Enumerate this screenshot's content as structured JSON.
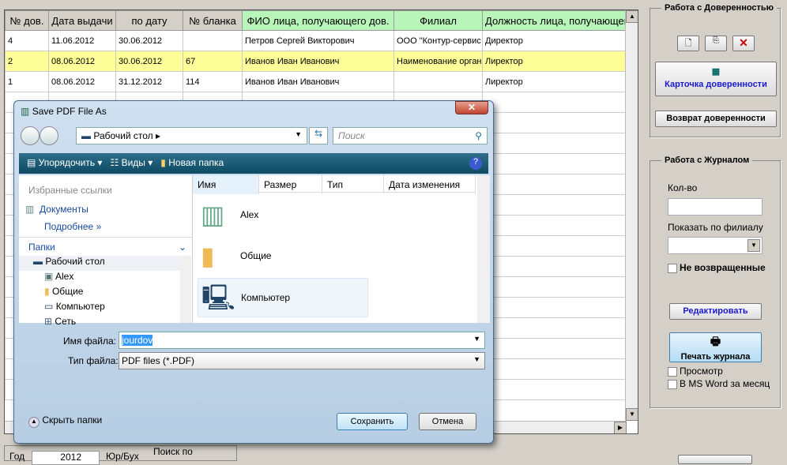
{
  "table": {
    "headers": [
      "№ дов.",
      "Дата выдачи",
      "по дату",
      "№ бланка",
      "ФИО лица, получающего дов.",
      "Филиал",
      "Должность лица, получающего"
    ],
    "rows": [
      [
        "4",
        "11.06.2012",
        "30.06.2012",
        "",
        "Петров Сергей Викторович",
        "ООО \"Контур-сервис",
        "Директор"
      ],
      [
        "2",
        "08.06.2012",
        "30.06.2012",
        "67",
        "Иванов Иван Иванович",
        "Наименование органи",
        "Лиректор"
      ],
      [
        "1",
        "08.06.2012",
        "31.12.2012",
        "114",
        "Иванов Иван Иванович",
        "",
        "Лиректор"
      ]
    ]
  },
  "panel1": {
    "title": "Работа с Доверенностью",
    "card": "Карточка доверенности",
    "return": "Возврат доверенности"
  },
  "panel2": {
    "title": "Работа с Журналом",
    "qty_label": "Кол-во",
    "qty": "",
    "branch_label": "Показать по филиалу",
    "branch": "",
    "not_returned": "Не возвращенные",
    "edit": "Редактировать",
    "print": "Печать журнала",
    "preview": "Просмотр",
    "msword": "В MS Word за месяц"
  },
  "bottom": {
    "year_label": "Год",
    "year": "2012",
    "type_label": "Юр/Бух",
    "search_label": "Поиск по"
  },
  "dialog": {
    "title": "Save PDF File As",
    "address": "Рабочий стол",
    "search_placeholder": "Поиск",
    "organize": "Упорядочить",
    "views": "Виды",
    "new_folder": "Новая папка",
    "favorites": "Избранные ссылки",
    "documents": "Документы",
    "more": "Подробнее",
    "folders": "Папки",
    "tree": [
      "Рабочий стол",
      "Alex",
      "Общие",
      "Компьютер",
      "Сеть"
    ],
    "columns": [
      "Имя",
      "Размер",
      "Тип",
      "Дата изменения"
    ],
    "items": [
      "Alex",
      "Общие",
      "Компьютер"
    ],
    "filename_label": "Имя файла:",
    "filename": "jourdov",
    "filetype_label": "Тип файла:",
    "filetype": "PDF files (*.PDF)",
    "hide": "Скрыть папки",
    "save": "Сохранить",
    "cancel": "Отмена"
  }
}
